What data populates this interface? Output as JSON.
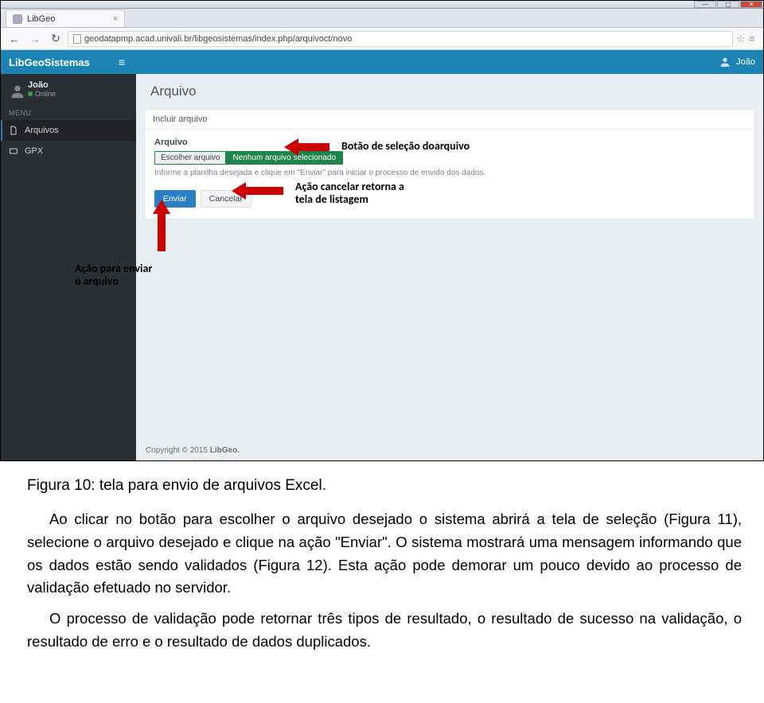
{
  "os_window": {
    "tab": {
      "title": "LibGeo",
      "close": "×"
    },
    "nav": {
      "back": "←",
      "forward": "→",
      "reload": "↻"
    },
    "url": "geodatapmp.acad.univali.br/libgeosistemas/index.php/arquivoct/novo",
    "star": "☆",
    "burger": "≡"
  },
  "header": {
    "brand": "LibGeoSistemas",
    "hamburger": "≡",
    "user": "João"
  },
  "sidebar": {
    "user_name": "João",
    "user_status": "Online",
    "menu_title": "MENU",
    "items": [
      {
        "label": "Arquivos"
      },
      {
        "label": "GPX"
      }
    ]
  },
  "page": {
    "title": "Arquivo",
    "panel_head": "Incluir arquivo",
    "form_label": "Arquivo",
    "choose_btn": "Escolher arquivo",
    "no_file": "Nenhum arquivo selecionado",
    "help_text": "Informe a planilha desejada e clique em \"Enviar\" para iniciar o processo de envido dos dados.",
    "submit": "Enviar",
    "cancel": "Cancelar"
  },
  "footer": {
    "copyright": "Copyright © 2015 ",
    "brand": "LibGeo."
  },
  "annotations": {
    "select_btn": "Botão de seleção doarquivo",
    "cancel_line1": "Ação cancelar retorna a",
    "cancel_line2": "tela de listagem",
    "send_line1": "Ação para enviar",
    "send_line2": "o arquivo"
  },
  "doc": {
    "caption": "Figura 10: tela para envio de arquivos Excel.",
    "para1": "Ao clicar no botão para escolher o arquivo desejado o sistema abrirá a tela de seleção (Figura 11), selecione o arquivo desejado e clique na ação \"Enviar\". O sistema mostrará uma mensagem informando que os dados estão sendo validados (Figura 12). Esta ação pode demorar um pouco devido ao processo de validação efetuado no servidor.",
    "para2": "O processo de validação pode retornar três tipos de resultado, o resultado de sucesso na validação, o resultado de erro e o resultado de dados duplicados."
  }
}
